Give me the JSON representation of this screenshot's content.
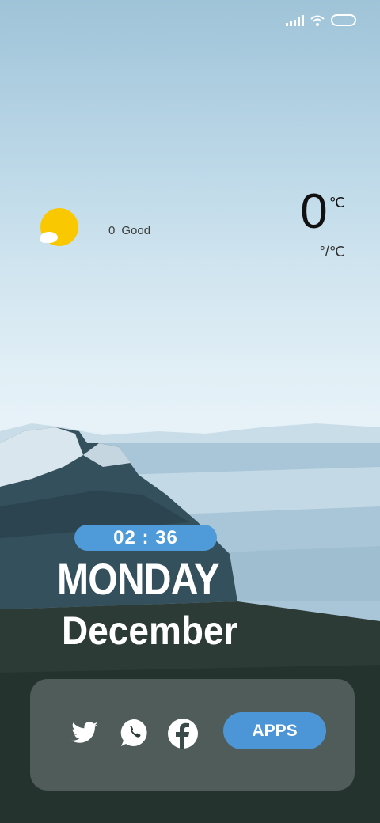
{
  "status_bar": {
    "icons": [
      "signal-icon",
      "wifi-icon",
      "battery-icon"
    ]
  },
  "weather": {
    "icon": "partly-sunny-icon",
    "aqi_value": "0",
    "aqi_label": "Good",
    "temperature": "0",
    "temperature_unit": "℃",
    "range_text": "°/℃"
  },
  "clock": {
    "time": "02 : 36",
    "day": "MONDAY",
    "month": "December"
  },
  "dock": {
    "icons": [
      "twitter-icon",
      "whatsapp-icon",
      "facebook-icon"
    ],
    "apps_label": "APPS"
  },
  "colors": {
    "accent": "#4f9ad8",
    "sun": "#f9c800"
  }
}
